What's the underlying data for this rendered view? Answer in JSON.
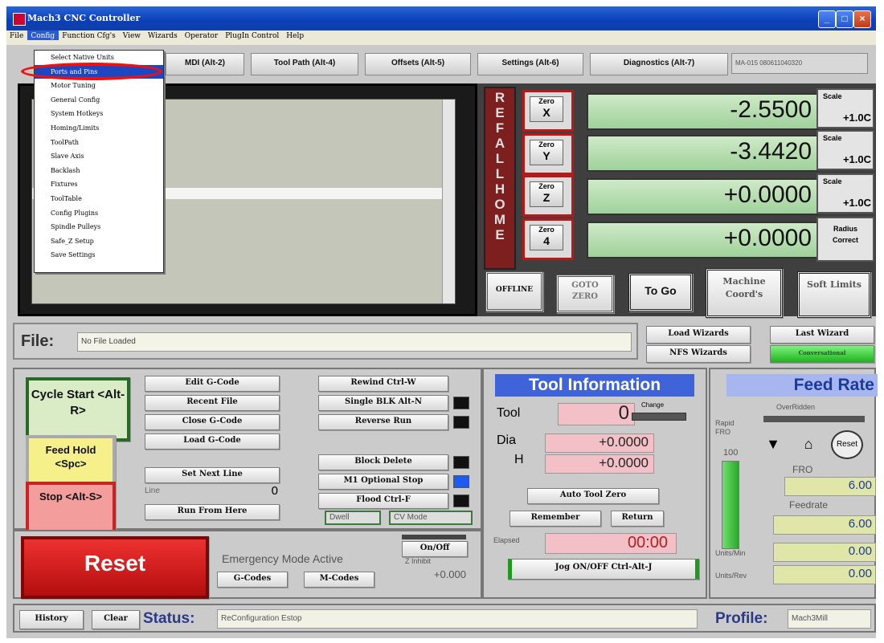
{
  "window": {
    "title": "Mach3 CNC Controller",
    "min_label": "_",
    "max_label": "□",
    "close_label": "×"
  },
  "menu": [
    "File",
    "Config",
    "Function Cfg's",
    "View",
    "Wizards",
    "Operator",
    "PlugIn Control",
    "Help"
  ],
  "config_menu": [
    "Select Native Units",
    "Ports and Pins",
    "Motor Tuning",
    "General Config",
    "System Hotkeys",
    "Homing/Limits",
    "ToolPath",
    "Slave Axis",
    "Backlash",
    "Fixtures",
    "ToolTable",
    "Config Plugins",
    "Spindle Pulleys",
    "Safe_Z Setup",
    "Save Settings"
  ],
  "tabs": [
    "MDI (Alt-2)",
    "Tool Path (Alt-4)",
    "Offsets (Alt-5)",
    "Settings (Alt-6)",
    "Diagnostics (Alt-7)"
  ],
  "tab_info": "MA-015 080611040320",
  "ref_all_home": [
    "R",
    "E",
    "F",
    "A",
    "L",
    "L",
    "H",
    "O",
    "M",
    "E"
  ],
  "axes": [
    {
      "zero": "Zero",
      "axis": "X",
      "value": "-2.5500",
      "scale_label": "Scale",
      "scale": "+1.0C"
    },
    {
      "zero": "Zero",
      "axis": "Y",
      "value": "-3.4420",
      "scale_label": "Scale",
      "scale": "+1.0C"
    },
    {
      "zero": "Zero",
      "axis": "Z",
      "value": "+0.0000",
      "scale_label": "Scale",
      "scale": "+1.0C"
    },
    {
      "zero": "Zero",
      "axis": "4",
      "value": "+0.0000",
      "scale_label": "Radius",
      "scale": "Correct"
    }
  ],
  "dro_buttons": {
    "offline": "OFFLINE",
    "gotozero": "GOTO ZERO",
    "togo": "To Go",
    "machine": "Machine Coord's",
    "soft": "Soft Limits"
  },
  "file": {
    "label": "File:",
    "value": "No File Loaded"
  },
  "wizards": {
    "load": "Load Wizards",
    "last": "Last Wizard",
    "nfs": "NFS Wizards",
    "conversational": "Conversational"
  },
  "program": {
    "cycle_start": "Cycle Start <Alt-R>",
    "feed_hold": "Feed Hold <Spc>",
    "stop": "Stop <Alt-S>",
    "edit": "Edit G-Code",
    "recent": "Recent File",
    "close": "Close G-Code",
    "load": "Load G-Code",
    "set_next": "Set Next Line",
    "line_label": "Line",
    "line_value": "0",
    "run_here": "Run From Here",
    "rewind": "Rewind Ctrl-W",
    "single": "Single BLK Alt-N",
    "reverse": "Reverse Run",
    "block_delete": "Block Delete",
    "m1": "M1 Optional Stop",
    "flood": "Flood Ctrl-F",
    "dwell": "Dwell",
    "cv_mode": "CV Mode"
  },
  "reset": {
    "label": "Reset",
    "emergency": "Emergency Mode Active",
    "gcodes": "G-Codes",
    "mcodes": "M-Codes",
    "onoff": "On/Off",
    "zinhibit": "Z Inhibit",
    "zvalue": "+0.000"
  },
  "tool": {
    "header": "Tool Information",
    "tool_label": "Tool",
    "tool_value": "0",
    "change": "Change",
    "dia_label": "Dia",
    "dia_value": "+0.0000",
    "h_label": "H",
    "h_value": "+0.0000",
    "auto_zero": "Auto Tool Zero",
    "remember": "Remember",
    "return": "Return",
    "elapsed_label": "Elapsed",
    "elapsed_value": "00:00",
    "jog": "Jog ON/OFF Ctrl-Alt-J"
  },
  "feed": {
    "header": "Feed Rate",
    "overridden": "OverRidden",
    "rapid_fro": "Rapid FRO",
    "rapid_value": "100",
    "reset": "Reset",
    "fro_label": "FRO",
    "fro_value": "6.00",
    "feedrate_label": "Feedrate",
    "feedrate_value": "6.00",
    "units_min_label": "Units/Min",
    "units_min_value": "0.00",
    "units_rev_label": "Units/Rev",
    "units_rev_value": "0.00",
    "fro_level": 1.0
  },
  "status": {
    "history": "History",
    "clear": "Clear",
    "label": "Status:",
    "value": "ReConfiguration Estop",
    "profile_label": "Profile:",
    "profile_value": "Mach3Mill"
  },
  "colors": {
    "dro_green": "#a6d6a0",
    "reset_red": "#c81414",
    "title_blue": "#0a3fb8"
  }
}
